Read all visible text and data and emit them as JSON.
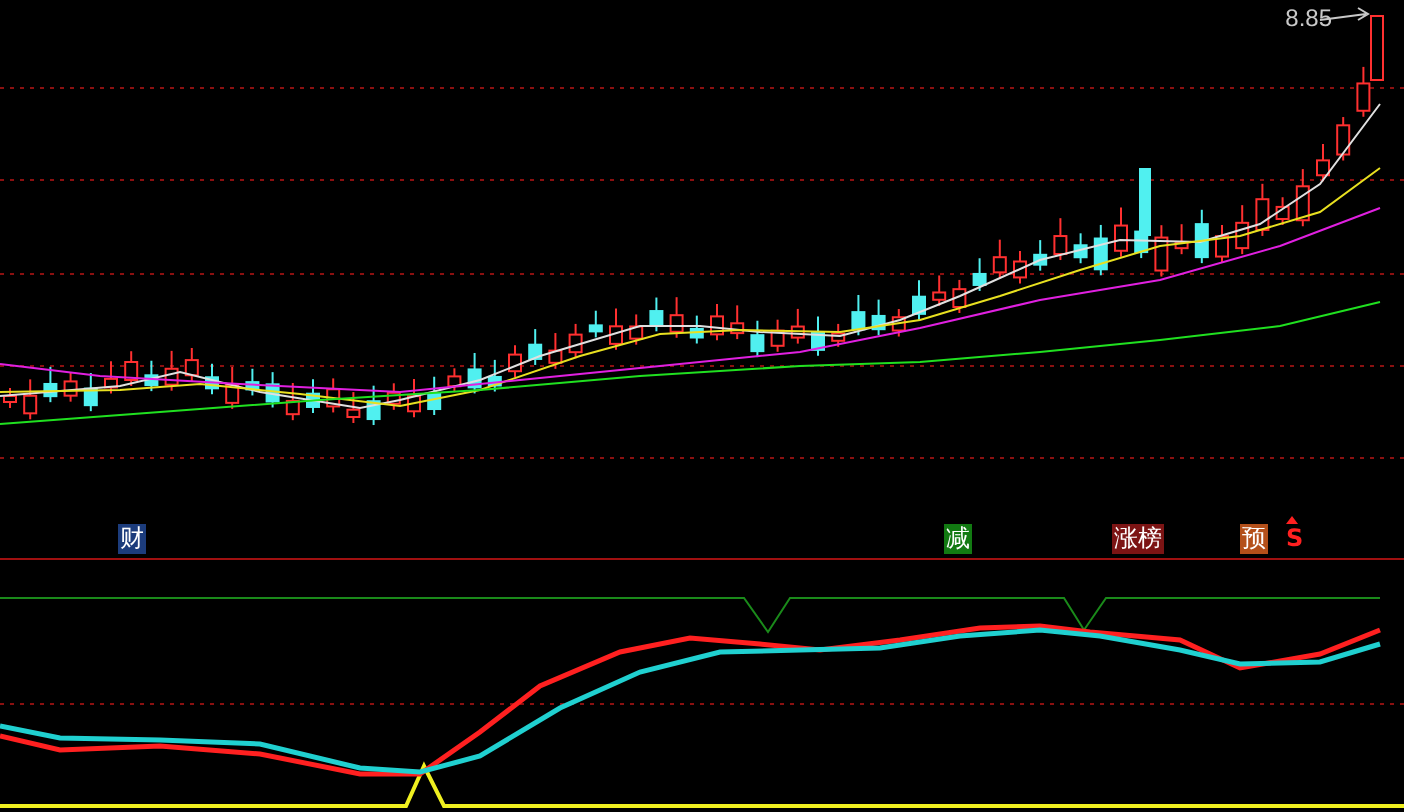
{
  "price_chart": {
    "high_label": "8.85"
  },
  "event_markers": [
    {
      "text": "财",
      "kind": "badge",
      "color": "#1c3c7c"
    },
    {
      "text": "减",
      "kind": "badge",
      "color": "#127a12"
    },
    {
      "text": "涨榜",
      "kind": "badge",
      "color": "#7c1414"
    },
    {
      "text": "预",
      "kind": "badge",
      "color": "#b4501a"
    },
    {
      "text": "S",
      "kind": "letter",
      "color": "#ff2020"
    }
  ]
}
